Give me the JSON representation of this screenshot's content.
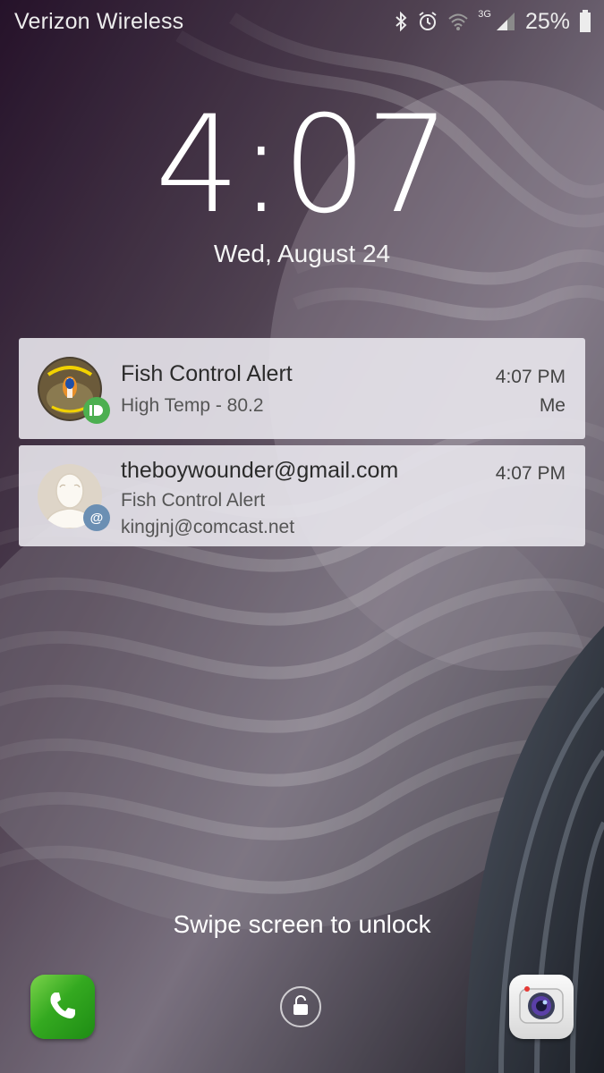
{
  "status_bar": {
    "carrier": "Verizon Wireless",
    "network": "3G",
    "battery": "25%",
    "icons": [
      "bluetooth-icon",
      "alarm-icon",
      "wifi-icon",
      "signal-icon",
      "battery-icon"
    ]
  },
  "lockscreen": {
    "time": "4:07",
    "date": "Wed, August 24",
    "swipe_hint": "Swipe screen to unlock"
  },
  "notifications": [
    {
      "title": "Fish Control Alert",
      "subtitle": "High Temp - 80.2",
      "time": "4:07 PM",
      "extra": "Me",
      "app_icon": "pushbullet-icon",
      "badge_color": "#4caf50"
    },
    {
      "title": "theboywounder@gmail.com",
      "subtitle": "Fish Control Alert",
      "detail": "kingjnj@comcast.net",
      "time": "4:07 PM",
      "app_icon": "email-icon",
      "badge_color": "#6b8fb3"
    }
  ],
  "shortcuts": {
    "left": "phone-icon",
    "center": "unlock-icon",
    "right": "camera-icon"
  }
}
